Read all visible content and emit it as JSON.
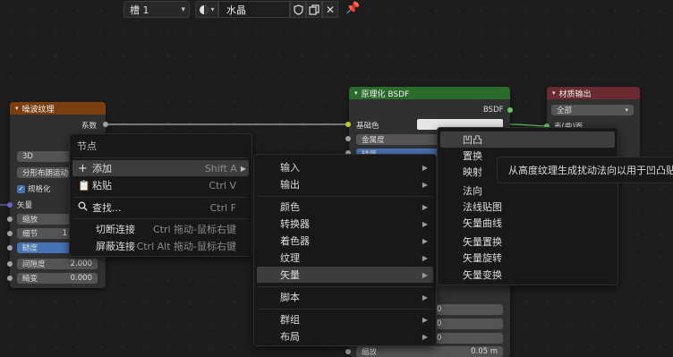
{
  "header": {
    "slot_label": "槽 1",
    "material_name": "水晶"
  },
  "nodes": {
    "noise": {
      "title": "噪波纹理",
      "output_factor": "系数",
      "dim": "3D",
      "basis": "分形布朗运动(",
      "normalize": "规格化",
      "vector": "矢量",
      "fields": [
        {
          "label": "缩放",
          "value": ""
        },
        {
          "label": "细节",
          "value": "1"
        },
        {
          "label": "糙度",
          "value": ""
        },
        {
          "label": "间隙度",
          "value": "2.000"
        },
        {
          "label": "畸变",
          "value": "0.000"
        }
      ]
    },
    "bsdf": {
      "title": "原理化 BSDF",
      "output": "BSDF",
      "base_color": "基础色",
      "metallic": "金属度",
      "roughness": "糙度",
      "scale_label": "缩放",
      "scale_value": "0.05 m",
      "partial_values": [
        "0",
        "0",
        "0"
      ]
    },
    "output": {
      "title": "材质输出",
      "target": "全部",
      "surface": "表(曲)面"
    }
  },
  "context_menu": {
    "title": "节点",
    "items": [
      {
        "label": "添加",
        "shortcut": "Shift A"
      },
      {
        "label": "粘贴",
        "shortcut": "Ctrl V"
      },
      {
        "label": "查找...",
        "shortcut": "Ctrl F"
      },
      {
        "label": "切断连接",
        "shortcut": "Ctrl 拖动-鼠标右键"
      },
      {
        "label": "屏蔽连接",
        "shortcut": "Ctrl Alt 拖动-鼠标右键"
      }
    ]
  },
  "add_menu": {
    "items": [
      "输入",
      "输出",
      "颜色",
      "转换器",
      "着色器",
      "纹理",
      "矢量",
      "脚本",
      "群组",
      "布局"
    ]
  },
  "vector_menu": {
    "items": [
      "凹凸",
      "置换",
      "映射",
      "法向",
      "法线贴图",
      "矢量曲线",
      "矢量置换",
      "矢量旋转",
      "矢量变换"
    ]
  },
  "tooltip": {
    "text": "从高度纹理生成扰动法向以用于凹凸贴图"
  }
}
